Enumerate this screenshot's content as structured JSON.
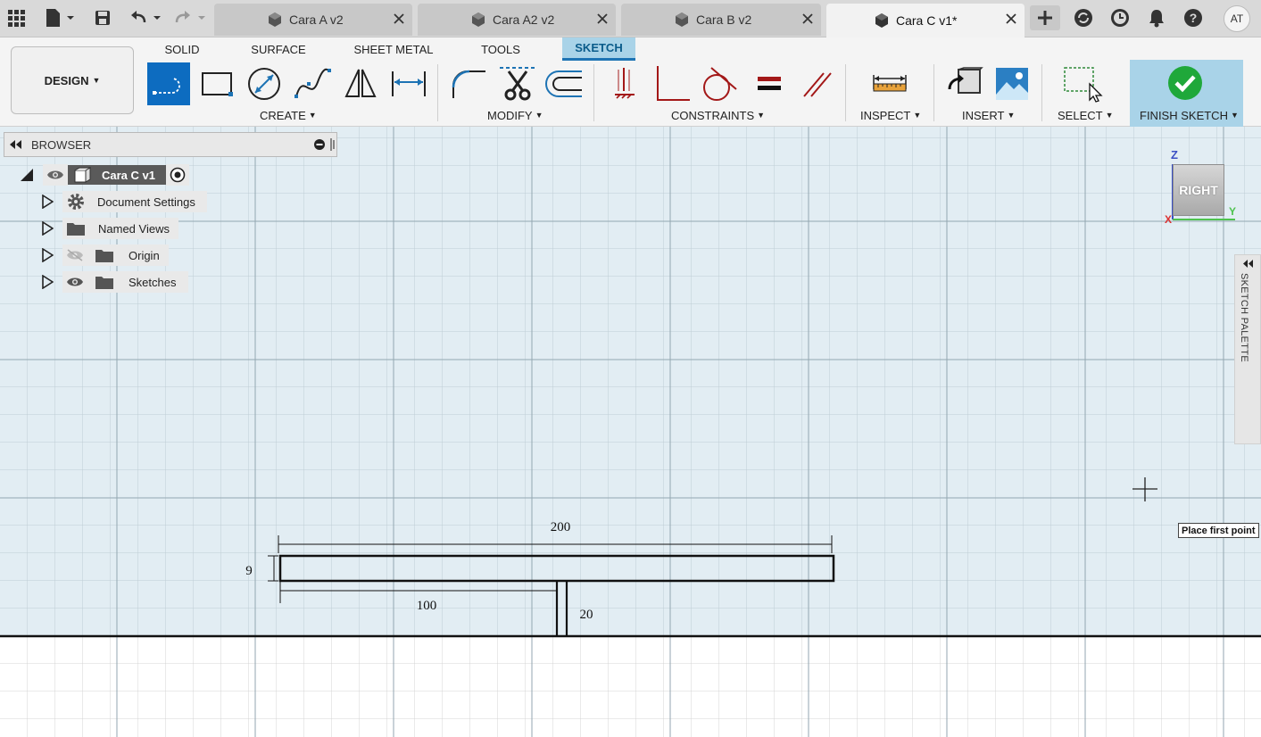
{
  "app": {
    "tabs": [
      {
        "label": "Cara A v2",
        "active": false
      },
      {
        "label": "Cara A2 v2",
        "active": false
      },
      {
        "label": "Cara B v2",
        "active": false
      },
      {
        "label": "Cara C v1*",
        "active": true
      }
    ],
    "user_initials": "AT"
  },
  "ribbon": {
    "workspace": "DESIGN",
    "tabs": [
      "SOLID",
      "SURFACE",
      "SHEET METAL",
      "TOOLS",
      "SKETCH"
    ],
    "active_tab": "SKETCH",
    "groups": {
      "create": "CREATE",
      "modify": "MODIFY",
      "constraints": "CONSTRAINTS",
      "inspect": "INSPECT",
      "insert": "INSERT",
      "select": "SELECT",
      "finish": "FINISH SKETCH"
    },
    "accent": "#0d6cc0",
    "active_tab_bg": "#a9d3e8"
  },
  "browser": {
    "title": "BROWSER",
    "root": "Cara C v1",
    "items": [
      "Document Settings",
      "Named Views",
      "Origin",
      "Sketches"
    ]
  },
  "viewcube": {
    "face": "RIGHT",
    "axis_z": "Z",
    "axis_x": "X",
    "axis_y": "Y"
  },
  "sketch_palette": "SKETCH PALETTE",
  "tooltip": "Place first point",
  "dimensions": {
    "width": "200",
    "height": "9",
    "offset": "100",
    "stem": "20"
  }
}
